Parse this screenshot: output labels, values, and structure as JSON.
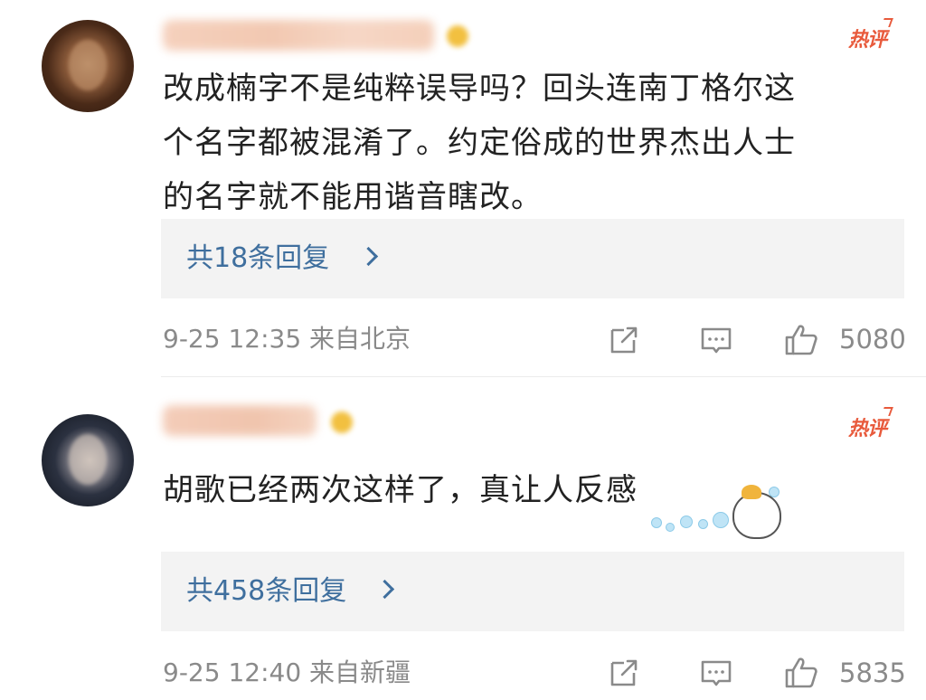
{
  "comments": [
    {
      "hot_label": "热评",
      "text_lines": [
        "改成楠字不是纯粹误导吗？回头连南丁格尔这",
        "个名字都被混淆了。约定俗成的世界杰出人士",
        "的名字就不能用谐音瞎改。"
      ],
      "replies_label": "共18条回复",
      "meta": "9-25 12:35 来自北京",
      "likes": "5080",
      "has_sticker": false
    },
    {
      "hot_label": "热评",
      "text_lines": [
        "胡歌已经两次这样了，真让人反感"
      ],
      "replies_label": "共458条回复",
      "meta": "9-25 12:40 来自新疆",
      "likes": "5835",
      "has_sticker": true
    }
  ],
  "icons": {
    "share": "share-icon",
    "reply": "comment-icon",
    "like": "thumbs-up-icon"
  },
  "colors": {
    "hot": "#e85a3c",
    "link": "#3f6f9e",
    "meta": "#8a8a8a",
    "text": "#222222",
    "reply_box": "#f3f3f3"
  }
}
